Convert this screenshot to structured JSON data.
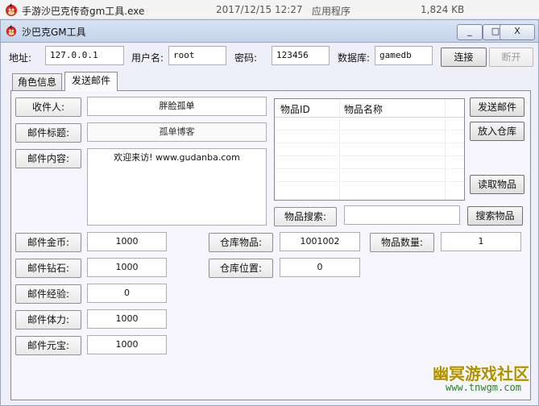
{
  "file_row": {
    "name": "手游沙巴克传奇gm工具.exe",
    "date": "2017/12/15 12:27",
    "type": "应用程序",
    "size": "1,824 KB"
  },
  "window": {
    "title": "沙巴克GM工具",
    "minimize": "_",
    "maximize": "□",
    "close": "X"
  },
  "connection": {
    "address_label": "地址:",
    "address_value": "127.0.0.1",
    "user_label": "用户名:",
    "user_value": "root",
    "password_label": "密码:",
    "password_value": "123456",
    "db_label": "数据库:",
    "db_value": "gamedb",
    "connect_button": "连接",
    "disconnect_button": "断开"
  },
  "tabs": [
    "角色信息",
    "发送邮件"
  ],
  "mail": {
    "recipient_label": "收件人:",
    "recipient_value": "胖脸孤单",
    "subject_label": "邮件标题:",
    "subject_value": "孤单博客",
    "content_label": "邮件内容:",
    "content_value": "欢迎来访! www.gudanba.com",
    "gold_label": "邮件金币:",
    "gold_value": "1000",
    "diamond_label": "邮件钻石:",
    "diamond_value": "1000",
    "exp_label": "邮件经验:",
    "exp_value": "0",
    "stamina_label": "邮件体力:",
    "stamina_value": "1000",
    "ingot_label": "邮件元宝:",
    "ingot_value": "1000"
  },
  "items": {
    "col_id": "物品ID",
    "col_name": "物品名称",
    "send_mail_button": "发送邮件",
    "put_warehouse_button": "放入仓库",
    "read_items_button": "读取物品",
    "search_label": "物品搜索:",
    "search_value": "",
    "search_button": "搜索物品",
    "warehouse_item_label": "仓库物品:",
    "warehouse_item_value": "1001002",
    "item_count_label": "物品数量:",
    "item_count_value": "1",
    "warehouse_pos_label": "仓库位置:",
    "warehouse_pos_value": "0"
  },
  "watermark": {
    "title": "幽冥游戏社区",
    "url": "www.tnwgm.com"
  },
  "colors": {
    "window_bg": "#eeeff8",
    "panel_bg": "#f5f5fb",
    "titlebar": "#c4d3ea",
    "watermark_gold": "#b09000",
    "watermark_green": "#2e7d2e"
  },
  "icons": {
    "app_icon": "angry-bird-icon"
  }
}
